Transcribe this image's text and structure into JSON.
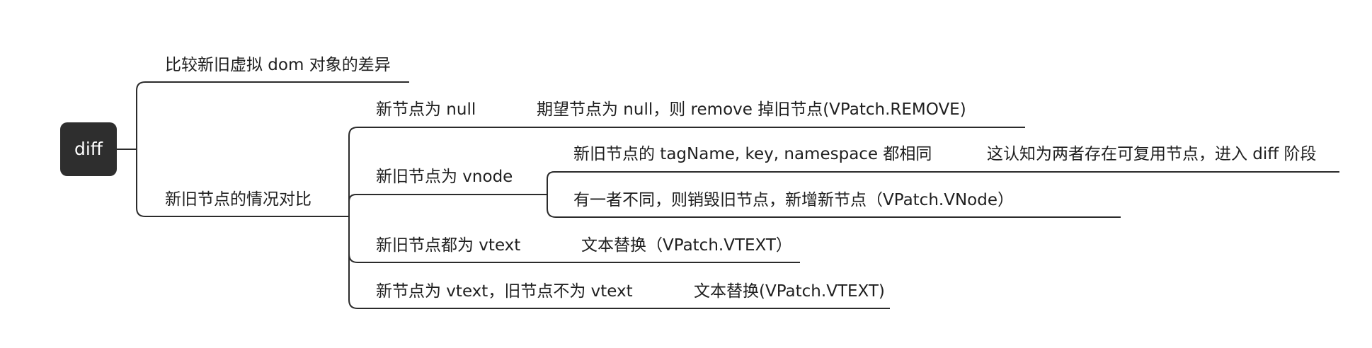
{
  "root": {
    "label": "diff"
  },
  "nodes": {
    "compare": {
      "label": "比较新旧虚拟 dom 对象的差异"
    },
    "cases": {
      "label": "新旧节点的情况对比"
    },
    "new_null": {
      "label": "新节点为 null"
    },
    "new_null_result": {
      "label": "期望节点为 null，则 remove 掉旧节点(VPatch.REMOVE)"
    },
    "both_vnode": {
      "label": "新旧节点为 vnode"
    },
    "same_tag": {
      "label": "新旧节点的 tagName, key, namespace 都相同"
    },
    "same_tag_result": {
      "label": "这认知为两者存在可复用节点，进入 diff 阶段"
    },
    "different": {
      "label": "有一者不同，则销毁旧节点，新增新节点（VPatch.VNode）"
    },
    "both_vtext": {
      "label": "新旧节点都为 vtext"
    },
    "both_vtext_result": {
      "label": "文本替换（VPatch.VTEXT）"
    },
    "new_vtext": {
      "label": "新节点为 vtext，旧节点不为 vtext"
    },
    "new_vtext_result": {
      "label": "文本替换(VPatch.VTEXT)"
    }
  },
  "colors": {
    "root_fill": "#2e2e2e",
    "root_text": "#ffffff",
    "line": "#2b2b2b",
    "text": "#1f1f1f"
  }
}
